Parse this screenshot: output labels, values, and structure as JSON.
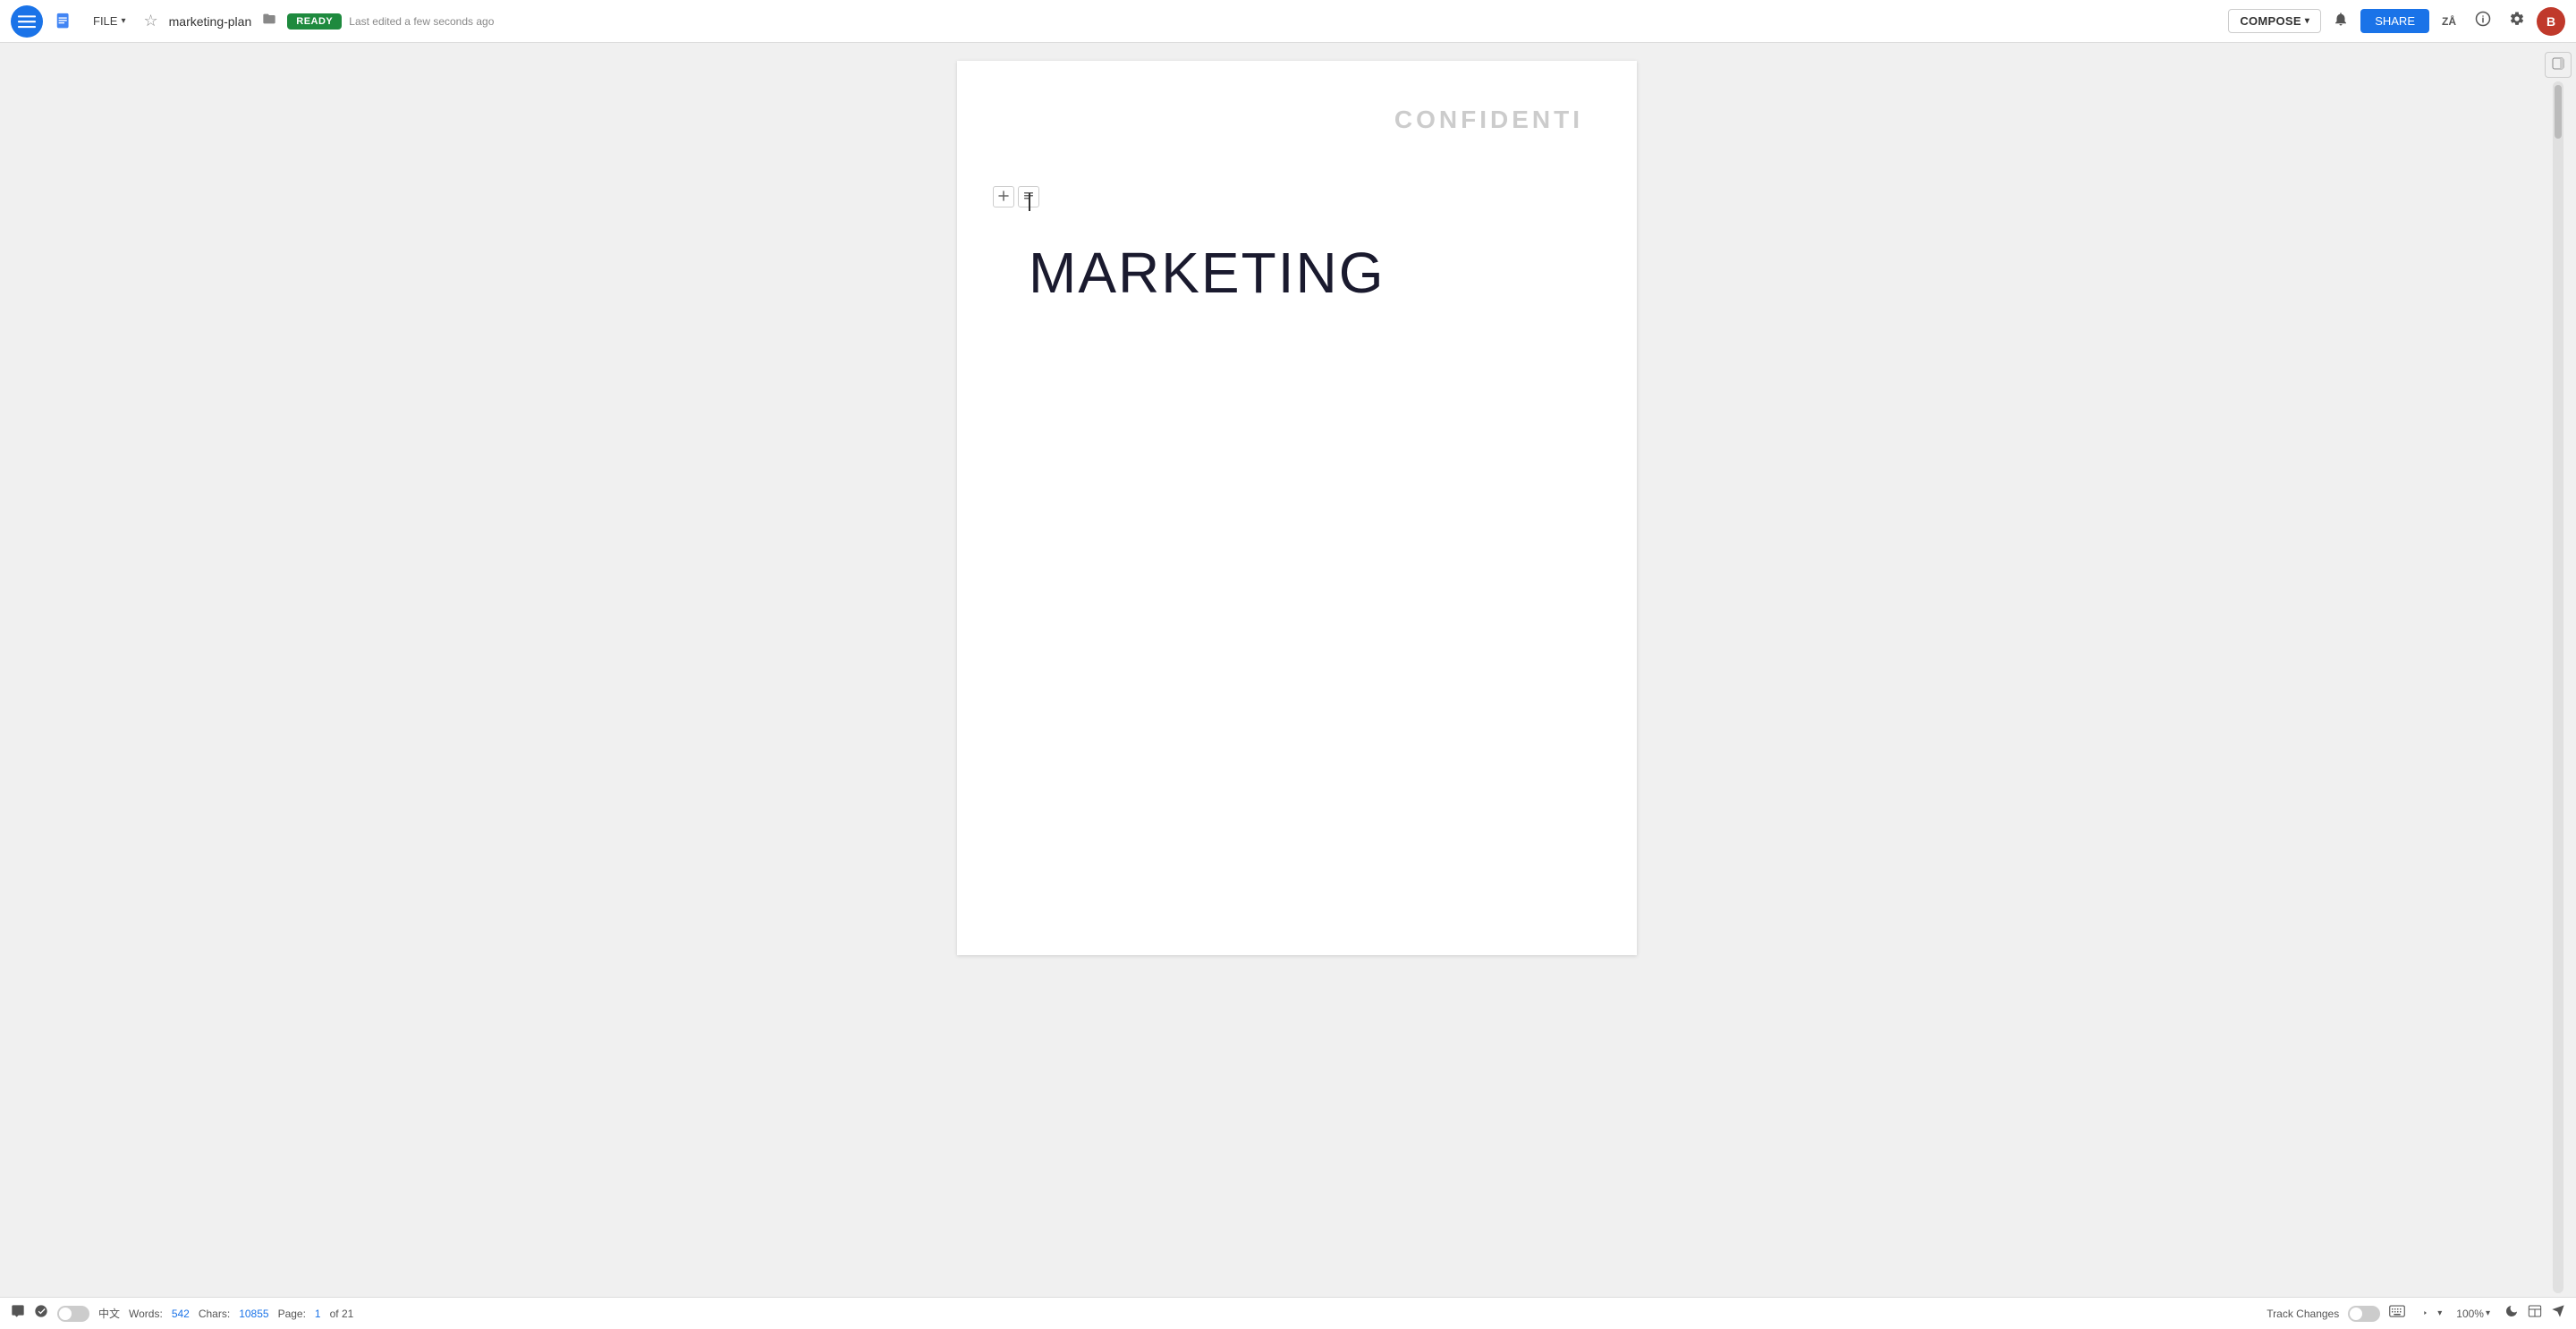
{
  "header": {
    "hamburger_label": "☰",
    "file_label": "FILE",
    "file_chevron": "▾",
    "star_label": "☆",
    "doc_title": "marketing-plan",
    "folder_label": "📁",
    "ready_label": "READY",
    "last_edited": "Last edited a few seconds ago",
    "compose_label": "COMPOSE",
    "compose_chevron": "▾",
    "share_label": "SHARE",
    "bell_icon": "🔔",
    "avatar_label": "B",
    "info_icon": "ℹ",
    "settings_icon": "⚙",
    "za_label": "ZÅ"
  },
  "page": {
    "watermark": "CONFIDENTI",
    "title": "MARKETING",
    "cursor_visible": true
  },
  "statusbar": {
    "words_label": "Words:",
    "words_count": "542",
    "chars_label": "Chars:",
    "chars_count": "10855",
    "page_label": "Page:",
    "page_current": "1",
    "page_of": "of 21",
    "track_changes_label": "Track Changes",
    "zoom_level": "100%",
    "zoom_chevron": "▾"
  },
  "right_panel": {
    "collapse_icon": "⊟"
  }
}
